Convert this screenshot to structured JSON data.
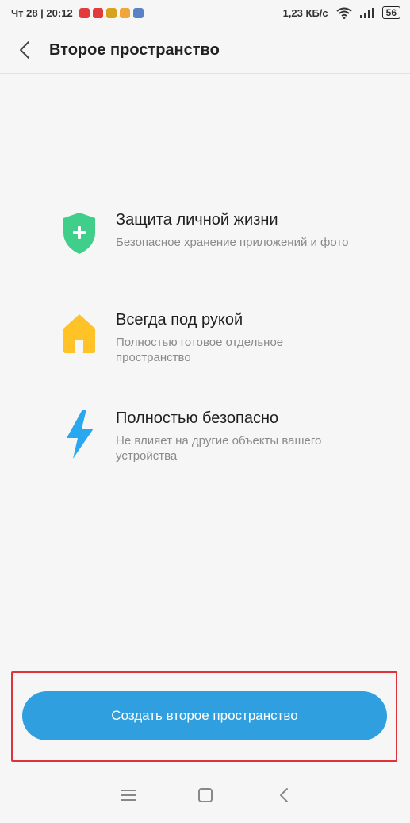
{
  "status_bar": {
    "datetime": "Чт 28 | 20:12",
    "speed": "1,23 КБ/с",
    "battery": "56"
  },
  "header": {
    "title": "Второе пространство"
  },
  "features": [
    {
      "icon": "shield-plus-icon",
      "title": "Защита личной жизни",
      "description": "Безопасное хранение приложений и фото"
    },
    {
      "icon": "home-icon",
      "title": "Всегда под рукой",
      "description": "Полностью готовое отдельное пространство"
    },
    {
      "icon": "lightning-icon",
      "title": "Полностью безопасно",
      "description": "Не влияет на другие объекты вашего устройства"
    }
  ],
  "action": {
    "create_label": "Создать второе пространство"
  },
  "colors": {
    "accent": "#2f9fdf",
    "shield": "#3fcf8a",
    "home": "#ffc227",
    "lightning": "#28a8f0",
    "highlight": "#e0323a"
  }
}
